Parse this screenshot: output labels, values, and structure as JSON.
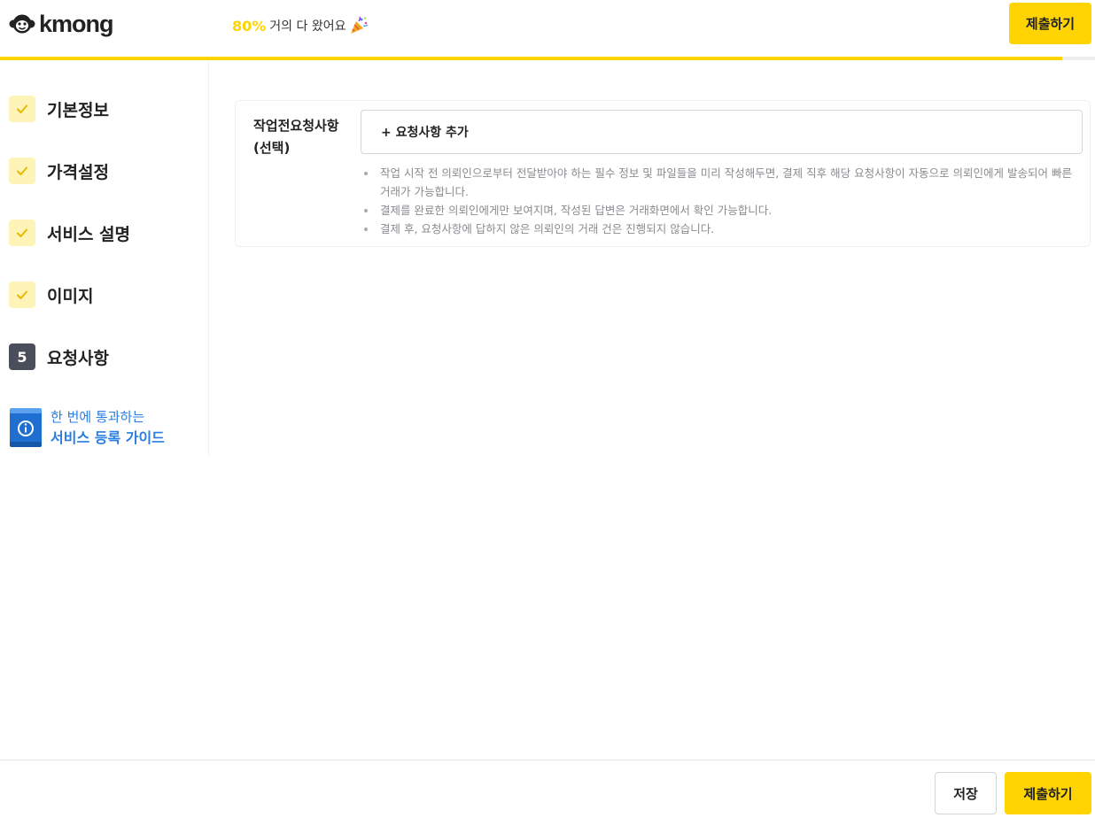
{
  "header": {
    "logo_text": "kmong",
    "progress_percent": "80%",
    "progress_message": "거의 다 왔어요",
    "progress_fraction": 0.97,
    "submit_label": "제출하기",
    "accent_color": "#FFD400"
  },
  "sidebar": {
    "steps": [
      {
        "label": "기본정보",
        "status": "done",
        "icon": "check-icon"
      },
      {
        "label": "가격설정",
        "status": "done",
        "icon": "check-icon"
      },
      {
        "label": "서비스 설명",
        "status": "done",
        "icon": "check-icon"
      },
      {
        "label": "이미지",
        "status": "done",
        "icon": "check-icon"
      },
      {
        "label": "요청사항",
        "status": "current",
        "number": "5"
      }
    ],
    "guide": {
      "line1": "한 번에 통과하는",
      "line2": "서비스 등록 가이드",
      "icon": "guide-book-icon"
    }
  },
  "main": {
    "field_label_1": "작업전요청사항",
    "field_label_2": "(선택)",
    "add_button_label": "+ 요청사항 추가",
    "notes": [
      "작업 시작 전 의뢰인으로부터 전달받아야 하는 필수 정보 및 파일들을 미리 작성해두면, 결제 직후 해당 요청사항이 자동으로 의뢰인에게 발송되어 빠른 거래가 가능합니다.",
      "결제를 완료한 의뢰인에게만 보여지며, 작성된 답변은 거래화면에서 확인 가능합니다.",
      "결제 후, 요청사항에 답하지 않은 의뢰인의 거래 건은 진행되지 않습니다."
    ]
  },
  "footer": {
    "save_label": "저장",
    "submit_label": "제출하기"
  }
}
